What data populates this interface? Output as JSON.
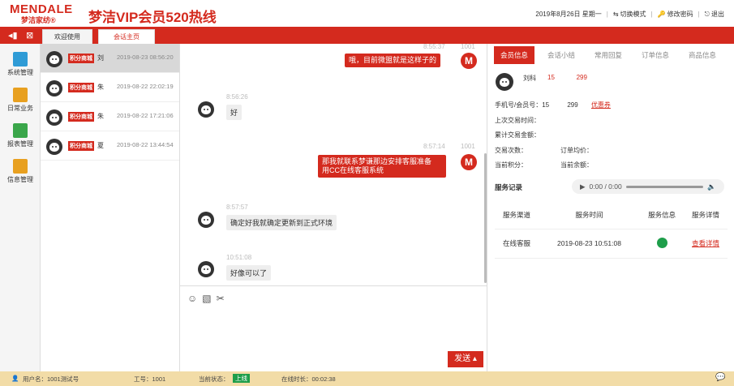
{
  "header": {
    "logo_en": "MENDALE",
    "logo_cn": "梦洁家纺®",
    "title": "梦洁VIP会员520热线",
    "date": "2019年8月26日 星期一",
    "switch_mode": "切换模式",
    "change_password": "修改密码",
    "logout": "退出"
  },
  "tabs": [
    {
      "label": "欢迎使用"
    },
    {
      "label": "会话主页"
    }
  ],
  "sidebar": {
    "items": [
      {
        "label": "系统管理",
        "color": "#2f9bd6"
      },
      {
        "label": "日常业务",
        "color": "#e8a020"
      },
      {
        "label": "报表管理",
        "color": "#3aa64a"
      },
      {
        "label": "信息管理",
        "color": "#e8a020"
      }
    ]
  },
  "conversations": [
    {
      "badge": "积分商城",
      "name": "刘",
      "time": "2019-08-23 08:56:20",
      "active": true
    },
    {
      "badge": "积分商城",
      "name": "朱",
      "time": "2019-08-22 22:02:19",
      "active": false
    },
    {
      "badge": "积分商城",
      "name": "朱",
      "time": "2019-08-22 17:21:06",
      "active": false
    },
    {
      "badge": "积分商城",
      "name": "夏",
      "time": "2019-08-22 13:44:54",
      "active": false
    }
  ],
  "messages": [
    {
      "side": "right",
      "time": "8:55:37",
      "sender_id": "1001",
      "text": "哦，目前微盟就是这样子的"
    },
    {
      "side": "left",
      "time": "8:56:26",
      "text": "好"
    },
    {
      "side": "right",
      "time": "8:57:14",
      "sender_id": "1001",
      "line1": "那我就联系梦谦那边安排客服准备",
      "line2": "用CC在线客服系统"
    },
    {
      "side": "left",
      "time": "8:57:57",
      "text": "确定好我就确定更新到正式环境"
    },
    {
      "side": "left",
      "time": "10:51:08",
      "text": "好像可以了"
    }
  ],
  "composer": {
    "send_label": "发送 ▴",
    "tools": [
      "emoji-icon",
      "image-icon",
      "scissors-icon"
    ]
  },
  "right_panel": {
    "tabs": [
      "会员信息",
      "会话小结",
      "常用回复",
      "订单信息",
      "商品信息"
    ],
    "user_name": "刘科",
    "user_phone": "15            299",
    "phone_label": "手机号/会员号：15          299",
    "coupon": "优惠券",
    "last_trade": "上次交易时间：",
    "total_amount": "累计交易金额：",
    "trade_count": "交易次数：",
    "avg_price": "订单均价：",
    "points": "当前积分：",
    "balance": "当前余额：",
    "service_title": "服务记录",
    "audio_time": "0:00 / 0:00",
    "table_headers": [
      "服务渠道",
      "服务时间",
      "服务信息",
      "服务详情"
    ],
    "rows": [
      {
        "channel": "在线客服",
        "time": "2019-08-23 10:51:08",
        "detail": "查看详情"
      }
    ]
  },
  "status_bar": {
    "user": "用户名：1001测试号",
    "job_no": "工号：1001",
    "state_label": "当前状态：",
    "state_value": "上线",
    "online_time": "在线时长：00:02:38"
  }
}
